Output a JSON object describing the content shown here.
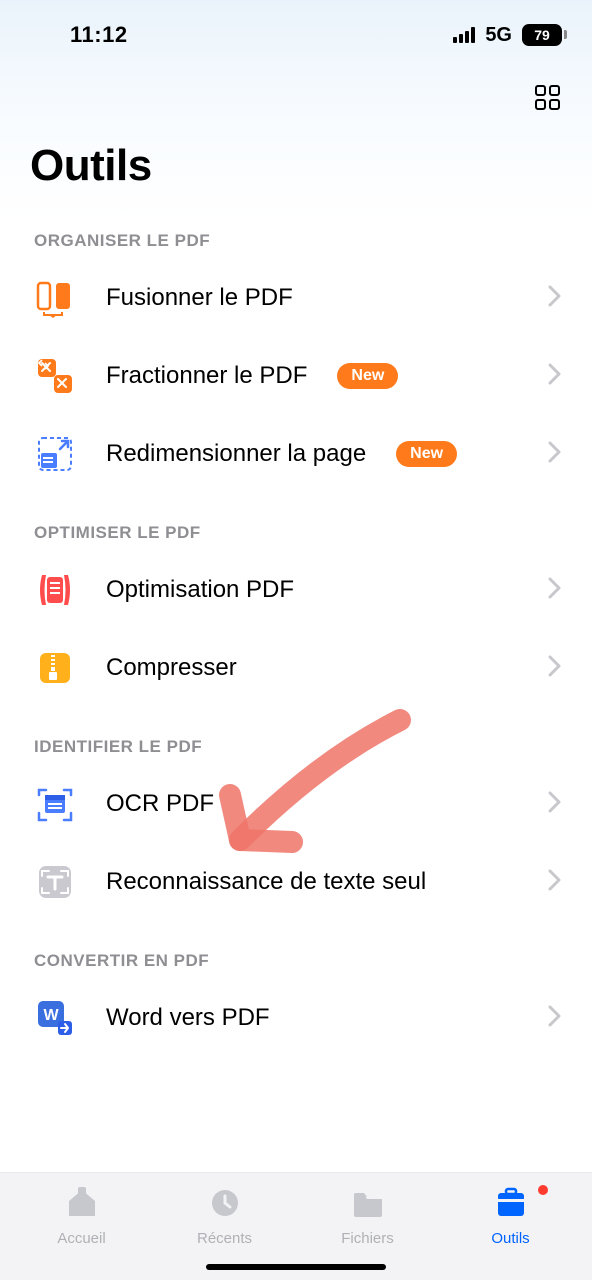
{
  "status": {
    "time": "11:12",
    "network": "5G",
    "battery": "79"
  },
  "header": {
    "title": "Outils"
  },
  "sections": {
    "organize": {
      "title": "ORGANISER LE PDF",
      "items": {
        "merge": {
          "label": "Fusionner le PDF"
        },
        "split": {
          "label": "Fractionner le PDF",
          "badge": "New"
        },
        "resize": {
          "label": "Redimensionner la page",
          "badge": "New"
        }
      }
    },
    "optimize": {
      "title": "OPTIMISER LE PDF",
      "items": {
        "optimize": {
          "label": "Optimisation PDF"
        },
        "compress": {
          "label": "Compresser"
        }
      }
    },
    "identify": {
      "title": "IDENTIFIER LE PDF",
      "items": {
        "ocr": {
          "label": "OCR PDF"
        },
        "text": {
          "label": "Reconnaissance de texte seul"
        }
      }
    },
    "convert": {
      "title": "CONVERTIR EN PDF",
      "items": {
        "word": {
          "label": "Word vers PDF"
        }
      }
    }
  },
  "tabs": {
    "home": "Accueil",
    "recents": "Récents",
    "files": "Fichiers",
    "tools": "Outils"
  }
}
